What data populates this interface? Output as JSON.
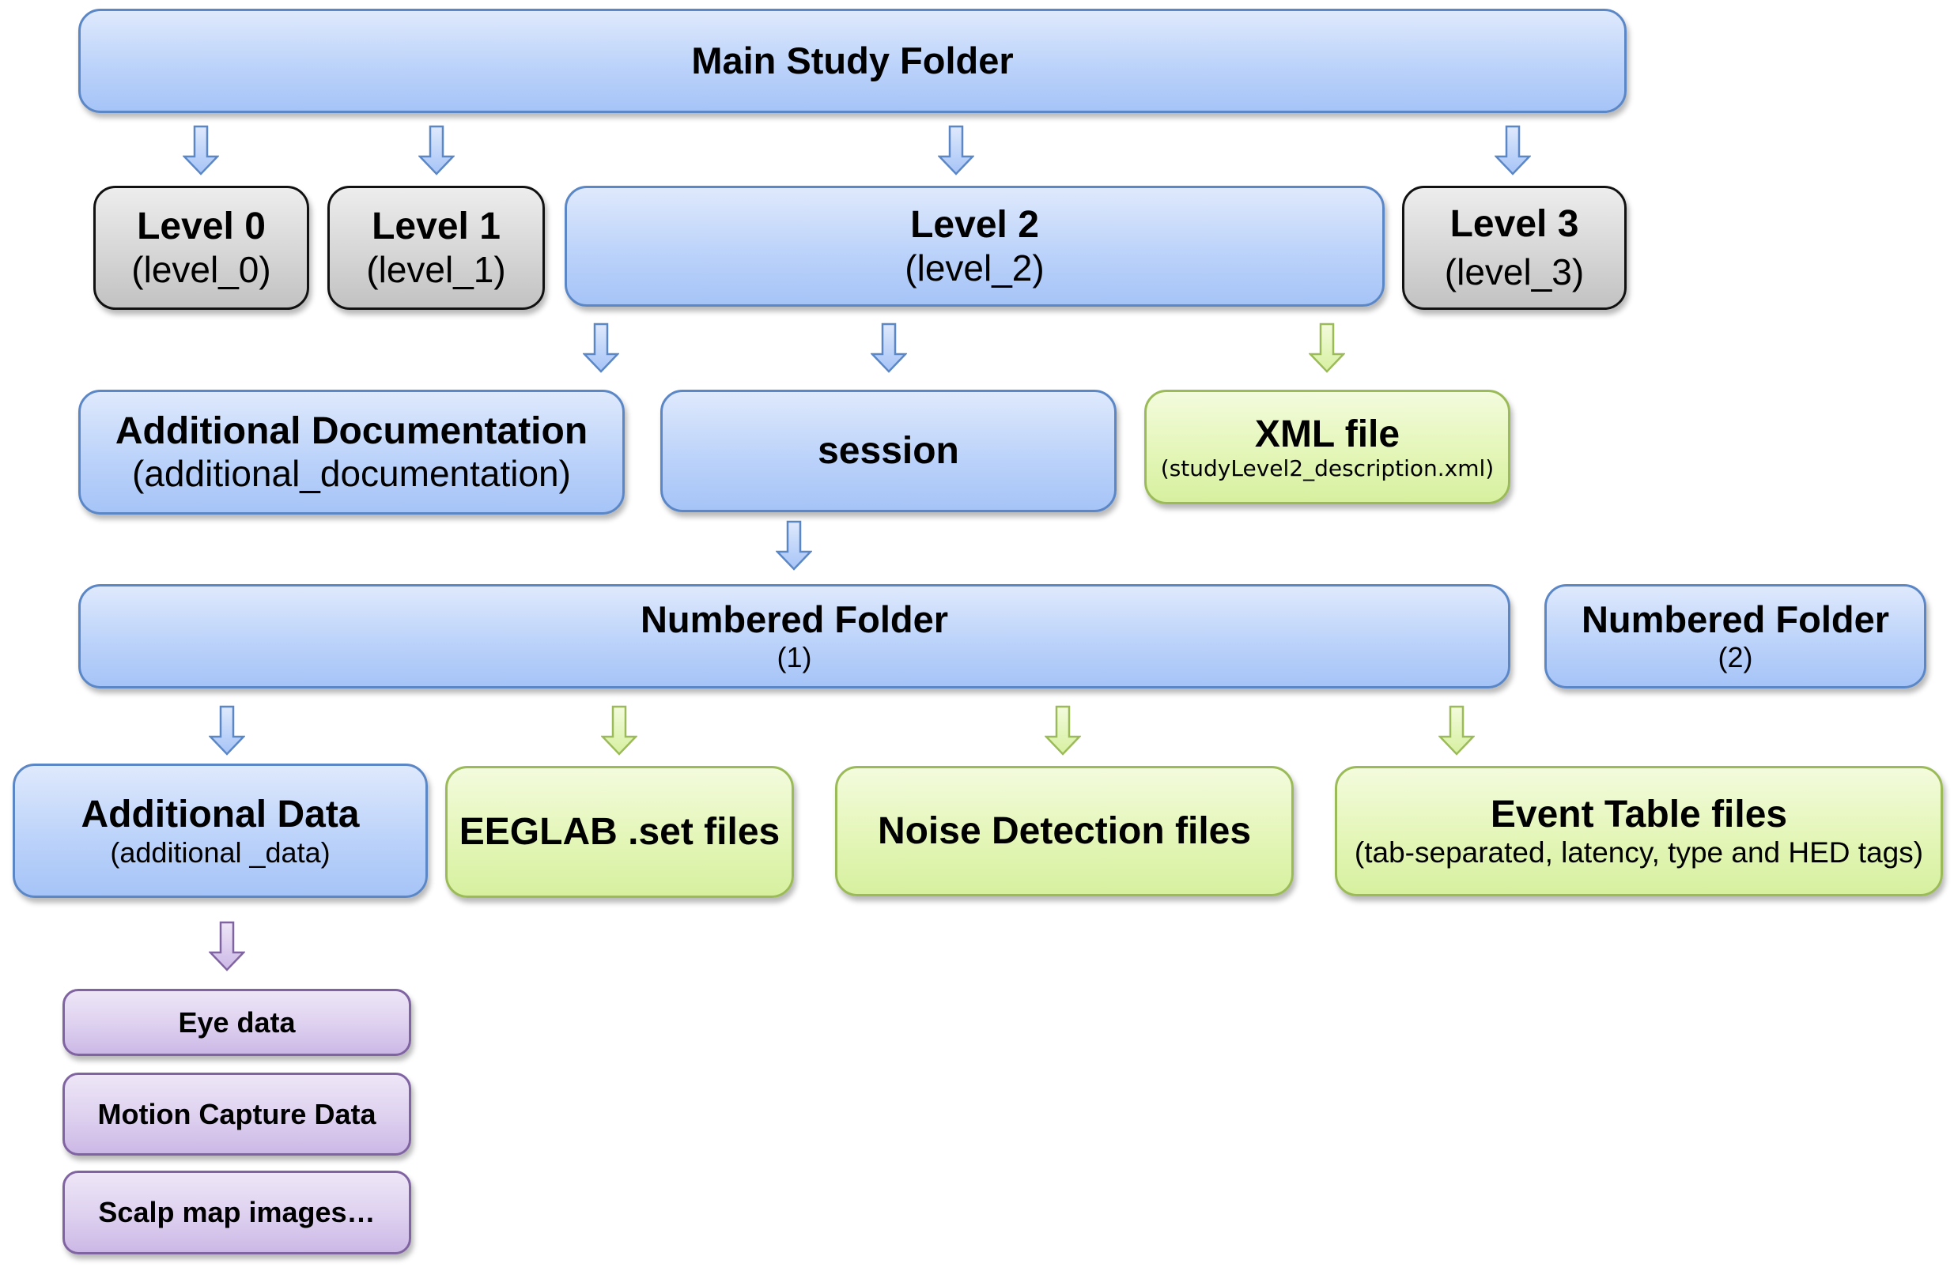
{
  "colors": {
    "folder_blue": "#a6c4f7",
    "folder_border": "#5b87c6",
    "level_gray": "#d6d6d6",
    "file_green": "#e4f6b8",
    "file_border": "#9bbb59",
    "extra_purple": "#ddd0ef",
    "extra_border": "#8064a2"
  },
  "main": {
    "title": "Main Study Folder"
  },
  "levels": [
    {
      "title": "Level 0",
      "sub": "(level_0)"
    },
    {
      "title": "Level 1",
      "sub": "(level_1)"
    },
    {
      "title": "Level 2",
      "sub": "(level_2)"
    },
    {
      "title": "Level 3",
      "sub": "(level_3)"
    }
  ],
  "level2_children": {
    "additional_documentation": {
      "title": "Additional Documentation",
      "sub": "(additional_documentation)"
    },
    "session": {
      "title": "session"
    },
    "xml_file": {
      "title": "XML file",
      "sub": "(studyLevel2_description.xml)"
    }
  },
  "numbered_folders": [
    {
      "title": "Numbered Folder",
      "sub": "(1)"
    },
    {
      "title": "Numbered Folder",
      "sub": "(2)"
    }
  ],
  "folder_contents": {
    "additional_data": {
      "title": "Additional Data",
      "sub": "(additional _data)"
    },
    "eeglab": {
      "title": "EEGLAB .set files"
    },
    "noise": {
      "title": "Noise Detection files"
    },
    "event_table": {
      "title": "Event Table files",
      "sub": "(tab-separated, latency, type and HED tags)"
    }
  },
  "additional_data_items": [
    {
      "title": "Eye data"
    },
    {
      "title": "Motion Capture Data"
    },
    {
      "title": "Scalp map images…"
    }
  ]
}
